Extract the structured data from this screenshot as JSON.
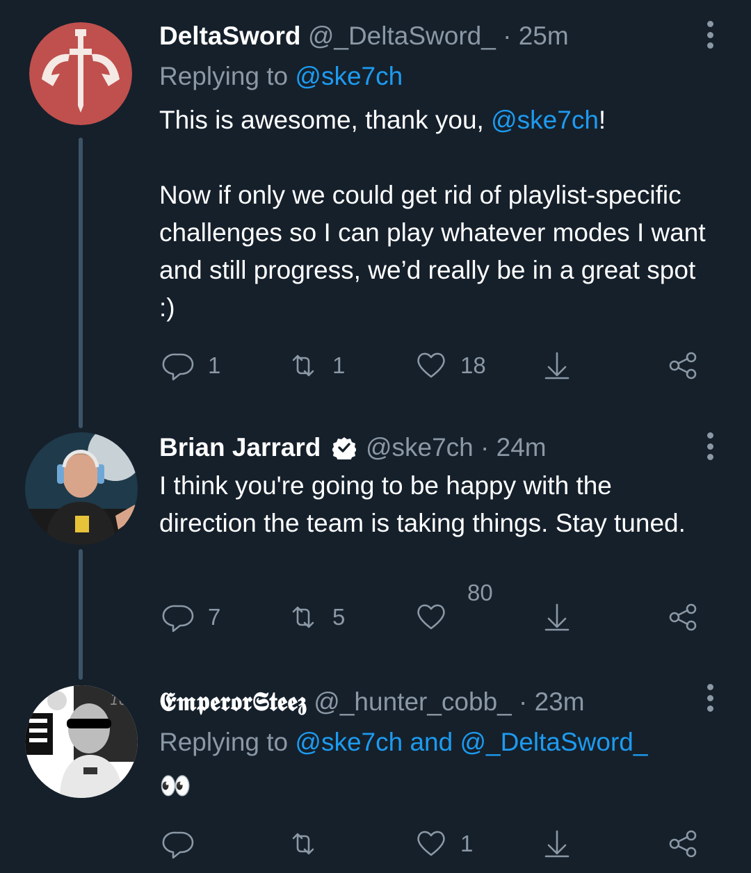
{
  "colors": {
    "background": "#15202b",
    "link": "#1d9bf0",
    "secondary_text": "#8b98a5",
    "thread_line": "#3d5466"
  },
  "tweets": [
    {
      "name": "DeltaSword",
      "handle": "@_DeltaSword_",
      "separator": "·",
      "time": "25m",
      "replying_prefix": "Replying to ",
      "replying_to": "@ske7ch",
      "body_part1": "This is awesome, thank you, ",
      "body_mention": "@ske7ch",
      "body_part2": "!",
      "body_para2": "Now if only we could get rid of playlist-specific challenges so I can play whatever modes I want and still progress, we’d really be in a great spot :)",
      "reply_count": "1",
      "retweet_count": "1",
      "like_count": "18"
    },
    {
      "name": "Brian Jarrard",
      "verified": true,
      "handle": "@ske7ch",
      "separator": "·",
      "time": "24m",
      "body": "I think you're going to be happy with the direction the team is taking things. Stay tuned.",
      "reply_count": "7",
      "retweet_count": "5",
      "like_count": "80"
    },
    {
      "name": "𝕰𝖒𝖕𝖊𝖗𝖔𝖗𝕾𝖙𝖊𝖊𝖟",
      "handle": "@_hunter_cobb_",
      "separator": "·",
      "time": "23m",
      "replying_prefix": "Replying to ",
      "replying_to": "@ske7ch and @_DeltaSword_",
      "body_emoji": "👀",
      "reply_count": "",
      "retweet_count": "",
      "like_count": "1"
    }
  ],
  "icons": {
    "reply": "reply-icon",
    "retweet": "retweet-icon",
    "like": "heart-icon",
    "download": "download-icon",
    "share": "share-icon",
    "more": "more-options-icon",
    "verified": "verified-badge-icon"
  }
}
